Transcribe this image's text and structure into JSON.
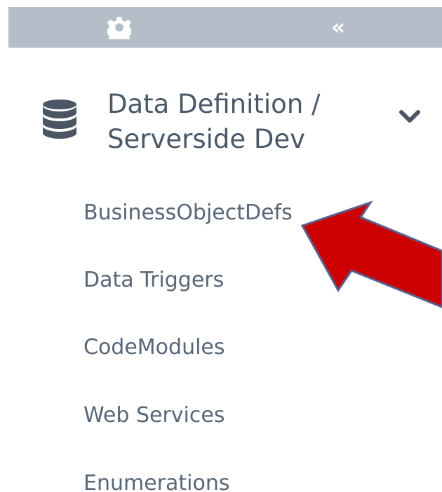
{
  "toolbar": {
    "settings_icon": "gear-icon",
    "collapse_icon": "double-chevron-left-icon",
    "collapse_glyph": "«",
    "background": "#b4bdc8"
  },
  "sidebar": {
    "group": {
      "icon": "database-icon",
      "line1": "Data Definition /",
      "line2": "Serverside Dev",
      "expanded_icon": "chevron-down-icon"
    },
    "items": [
      {
        "label": "BusinessObjectDefs"
      },
      {
        "label": "Data Triggers"
      },
      {
        "label": "CodeModules"
      },
      {
        "label": "Web Services"
      },
      {
        "label": "Enumerations"
      }
    ]
  },
  "annotation": {
    "type": "arrow",
    "color": "#cc0000",
    "outline": "#5a5f8a",
    "target": "BusinessObjectDefs"
  }
}
